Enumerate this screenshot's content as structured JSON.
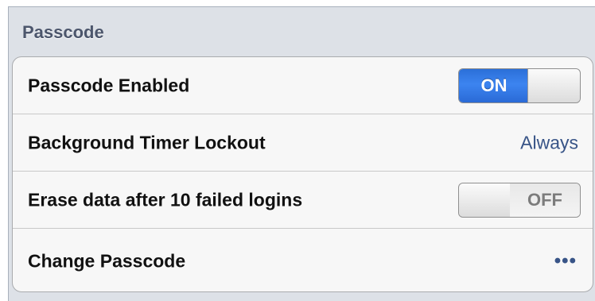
{
  "section": {
    "title": "Passcode"
  },
  "rows": [
    {
      "label": "Passcode Enabled",
      "control": "toggle",
      "state_label": "ON",
      "enabled": true
    },
    {
      "label": "Background Timer Lockout",
      "control": "value",
      "value": "Always"
    },
    {
      "label": "Erase data after 10 failed logins",
      "control": "toggle",
      "state_label": "OFF",
      "enabled": false
    },
    {
      "label": "Change Passcode",
      "control": "disclosure",
      "value": "•••"
    }
  ],
  "colors": {
    "toggle_on": "#3a80ec",
    "value_text": "#385487",
    "header_text": "#4c566c",
    "panel_bg": "#dde1e7"
  }
}
